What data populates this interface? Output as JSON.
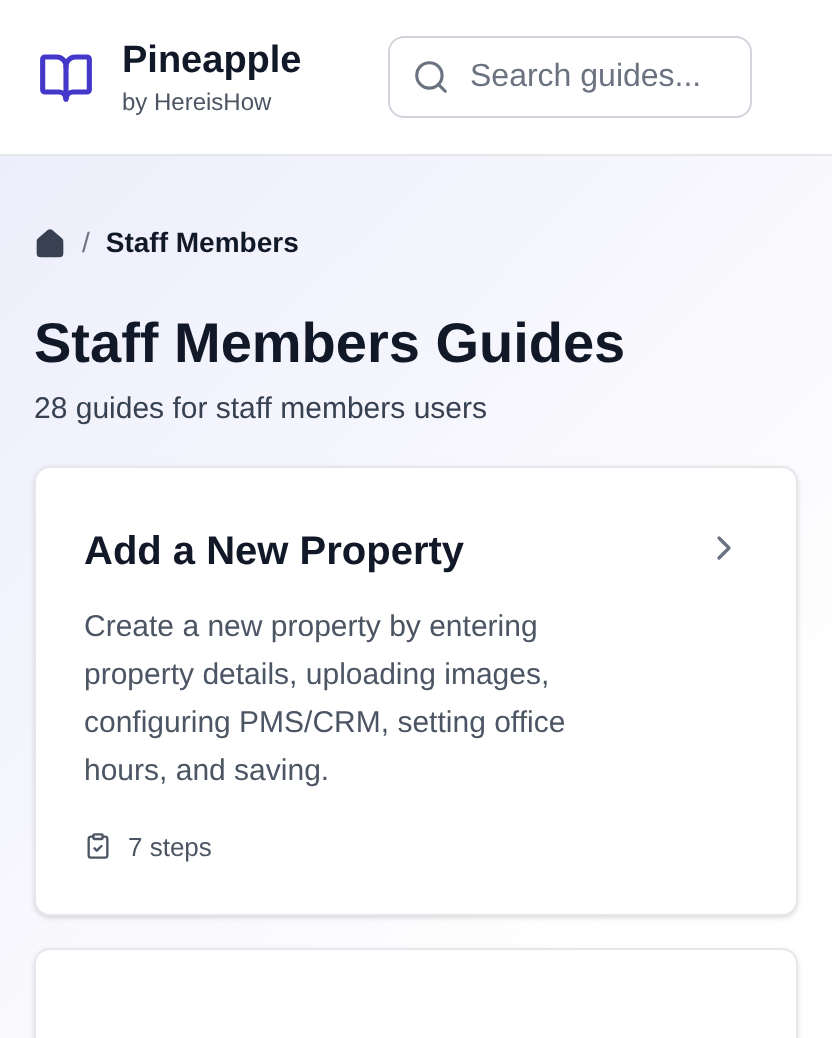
{
  "header": {
    "brand": {
      "name": "Pineapple",
      "byline": "by HereisHow"
    },
    "search": {
      "placeholder": "Search guides..."
    }
  },
  "breadcrumb": {
    "separator": "/",
    "items": [
      {
        "label": "Staff Members"
      }
    ]
  },
  "page": {
    "title": "Staff Members Guides",
    "subtitle": "28 guides for staff members users"
  },
  "guides": [
    {
      "title": "Add a New Property",
      "description": "Create a new property by entering property details, uploading images, configuring PMS/CRM, setting office hours, and saving.",
      "steps": "7 steps"
    }
  ]
}
